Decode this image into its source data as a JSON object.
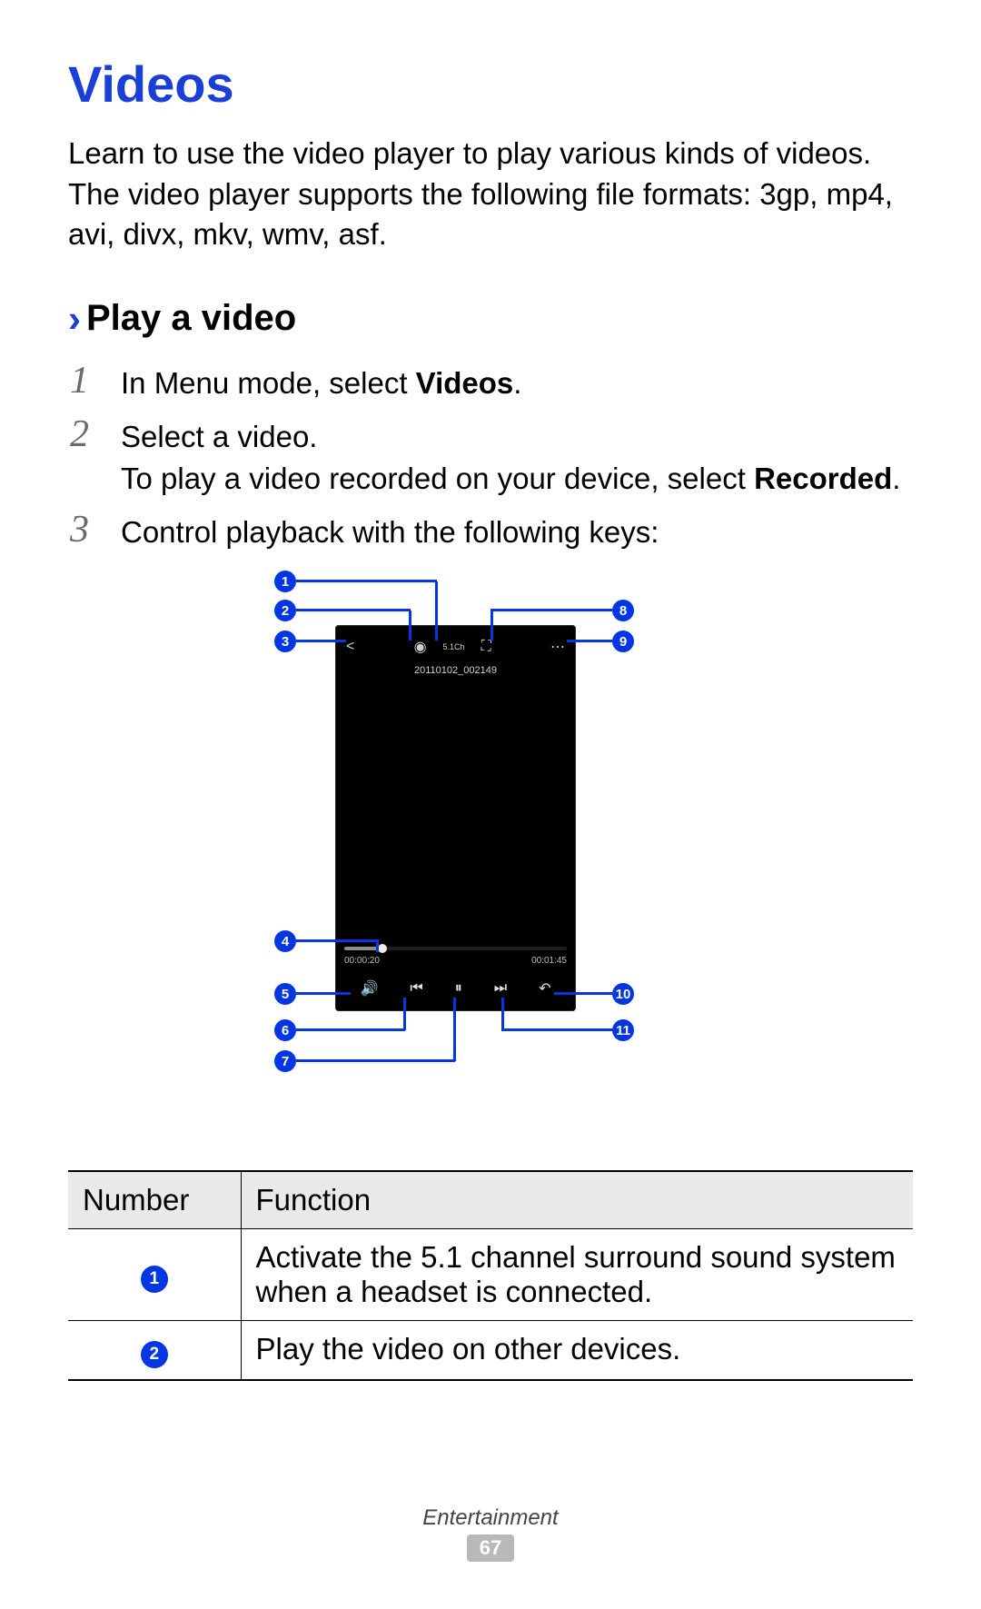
{
  "title": "Videos",
  "intro": "Learn to use the video player to play various kinds of videos. The video player supports the following file formats: 3gp, mp4, avi, divx, mkv, wmv, asf.",
  "section": {
    "chevron": "›",
    "heading": "Play a video"
  },
  "steps": {
    "s1": {
      "num": "1",
      "pre": "In Menu mode, select ",
      "bold": "Videos",
      "post": "."
    },
    "s2": {
      "num": "2",
      "line1": "Select a video.",
      "line2pre": "To play a a video recorded on your device, select ",
      "line2pre_fix": "To play a video recorded on your device, select ",
      "line2bold": "Recorded",
      "line2post": "."
    },
    "s3": {
      "num": "3",
      "text": "Control playback with the following keys:"
    }
  },
  "player": {
    "filename": "20110102_002149",
    "time_elapsed": "00:00:20",
    "time_total": "00:01:45",
    "top_mid_label": "5.1Ch"
  },
  "callouts": {
    "c1": "1",
    "c2": "2",
    "c3": "3",
    "c4": "4",
    "c5": "5",
    "c6": "6",
    "c7": "7",
    "c8": "8",
    "c9": "9",
    "c10": "10",
    "c11": "11"
  },
  "table": {
    "head_number": "Number",
    "head_function": "Function",
    "rows": [
      {
        "num": "1",
        "fn": "Activate the 5.1 channel surround sound system when a headset is connected."
      },
      {
        "num": "2",
        "fn": "Play the video on other devices."
      }
    ]
  },
  "footer": {
    "category": "Entertainment",
    "page": "67"
  }
}
